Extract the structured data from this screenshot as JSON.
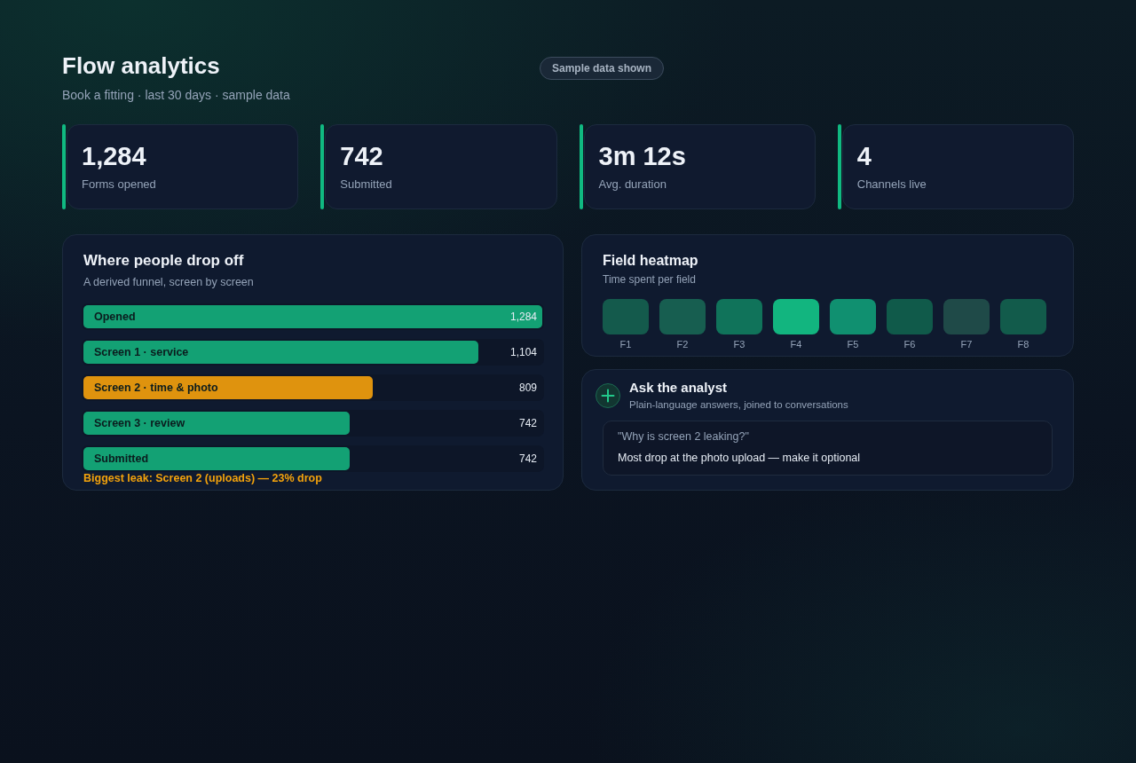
{
  "header": {
    "title": "Flow analytics",
    "subtitle": "Book a fitting · last 30 days · sample data",
    "badge": "Sample data shown"
  },
  "stats": [
    {
      "value": "1,284",
      "label": "Forms opened"
    },
    {
      "value": "742",
      "label": "Submitted"
    },
    {
      "value": "3m 12s",
      "label": "Avg. duration"
    },
    {
      "value": "4",
      "label": "Channels live"
    }
  ],
  "funnel": {
    "title": "Where people drop off",
    "subtitle": "A derived funnel, screen by screen",
    "rows": [
      {
        "label": "Opened",
        "value": "1,284",
        "level": 1,
        "color": "#13a174"
      },
      {
        "label": "Screen 1 · service",
        "value": "1,104",
        "level": 0.86,
        "color": "#13a174"
      },
      {
        "label": "Screen 2 · time & photo",
        "value": "809",
        "level": 0.63,
        "color": "#df930e"
      },
      {
        "label": "Screen 3 · review",
        "value": "742",
        "level": 0.58,
        "color": "#13a174"
      },
      {
        "label": "Submitted",
        "value": "742",
        "level": 0.58,
        "color": "#13a174"
      }
    ],
    "note": "Biggest leak: Screen 2 (uploads) — 23% drop"
  },
  "heatmap": {
    "title": "Field heatmap",
    "subtitle": "Time spent per field",
    "cells": [
      {
        "label": "F1",
        "color": "#145a4c"
      },
      {
        "label": "F2",
        "color": "#175e50"
      },
      {
        "label": "F3",
        "color": "#10735a"
      },
      {
        "label": "F4",
        "color": "#12b57f"
      },
      {
        "label": "F5",
        "color": "#109070"
      },
      {
        "label": "F6",
        "color": "#105a4a"
      },
      {
        "label": "F7",
        "color": "#1f4a48"
      },
      {
        "label": "F8",
        "color": "#125b4b"
      }
    ]
  },
  "analyst": {
    "title": "Ask the analyst",
    "subtitle": "Plain-language answers, joined to conversations",
    "question": "\"Why is screen 2 leaking?\"",
    "answer": "Most drop at the photo upload — make it optional"
  }
}
